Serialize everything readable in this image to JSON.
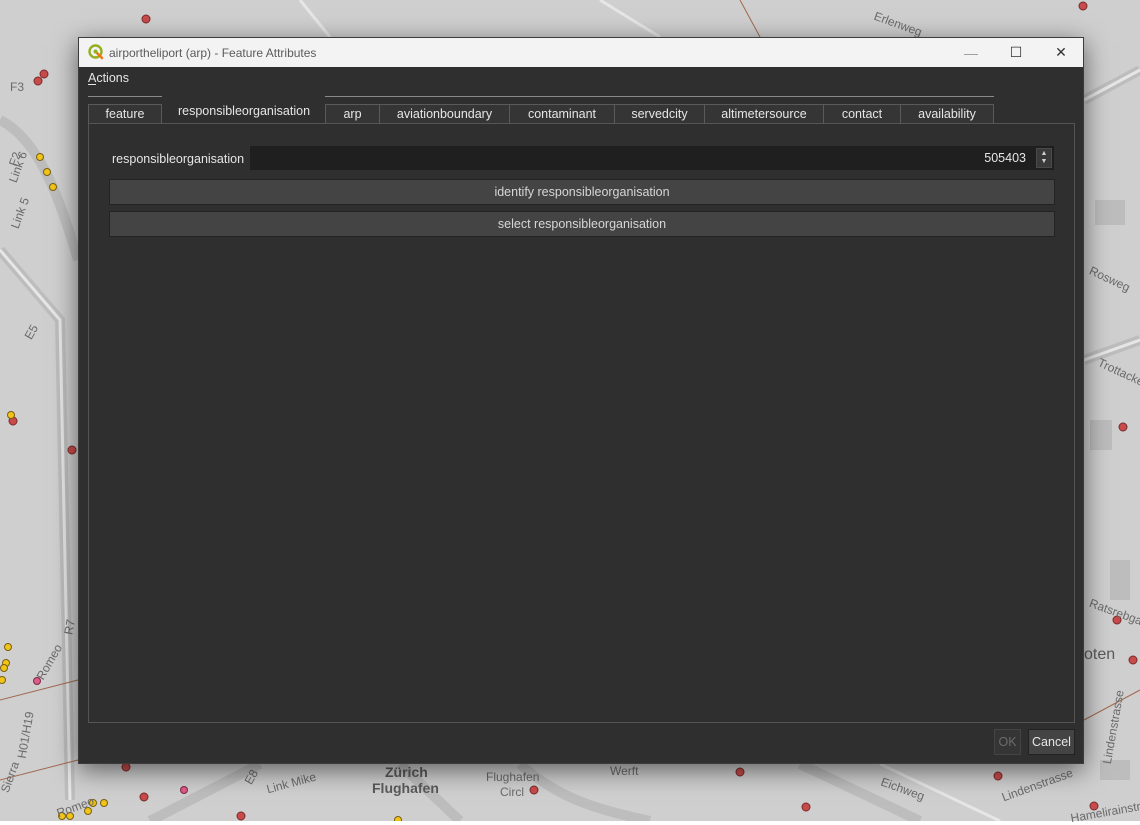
{
  "window": {
    "title": "airportheliport (arp) - Feature Attributes",
    "minimize_symbol": "—",
    "maximize_symbol": "☐",
    "close_symbol": "✕"
  },
  "menu": {
    "actions_label": "Actions"
  },
  "tabs": [
    {
      "label": "feature",
      "active": false
    },
    {
      "label": "responsibleorganisation",
      "active": true
    },
    {
      "label": "arp",
      "active": false
    },
    {
      "label": "aviationboundary",
      "active": false
    },
    {
      "label": "contaminant",
      "active": false
    },
    {
      "label": "servedcity",
      "active": false
    },
    {
      "label": "altimetersource",
      "active": false
    },
    {
      "label": "contact",
      "active": false
    },
    {
      "label": "availability",
      "active": false
    }
  ],
  "form": {
    "field_label": "responsibleorganisation",
    "field_value": "505403",
    "identify_button": "identify responsibleorganisation",
    "select_button": "select responsibleorganisation"
  },
  "buttons": {
    "ok": "OK",
    "cancel": "Cancel"
  },
  "map_labels": {
    "link6": "Link 6",
    "link5": "Link 5",
    "f3": "F3",
    "f2": "F2",
    "e5": "E5",
    "r7": "R7",
    "romeo_left": "Romeo",
    "sierra": "Sierra",
    "h01": "H01/H19",
    "link_mike": "Link Mike",
    "e8": "E8",
    "romeo_bottom": "Romeo",
    "zurich": "Zürich",
    "flughafen": "Flughafen",
    "flughafen2": "Flughafen",
    "circle": "Circl",
    "werft": "Werft",
    "erlenweg": "Erlenweg",
    "eichweg": "Eichweg",
    "lindenstrasse": "Lindenstrasse",
    "kloten": "oten",
    "trottacker": "Trottacker",
    "ratsrebgass": "Ratsrebgas",
    "rosweg": "Rosweg",
    "lindenstrasse2": "Lindenstrasse",
    "hamelirainstrasse": "Hamelirainstrasse"
  },
  "colors": {
    "dialog_bg": "#2f2f2f",
    "titlebar_bg": "#f3f3f3",
    "map_bg": "#cfcfcf",
    "marker_red": "#c84b4b",
    "marker_yellow": "#f0c419",
    "marker_pink": "#e05a88"
  },
  "icons": {
    "app": "qgis-icon",
    "spin_up": "▲",
    "spin_down": "▼"
  }
}
